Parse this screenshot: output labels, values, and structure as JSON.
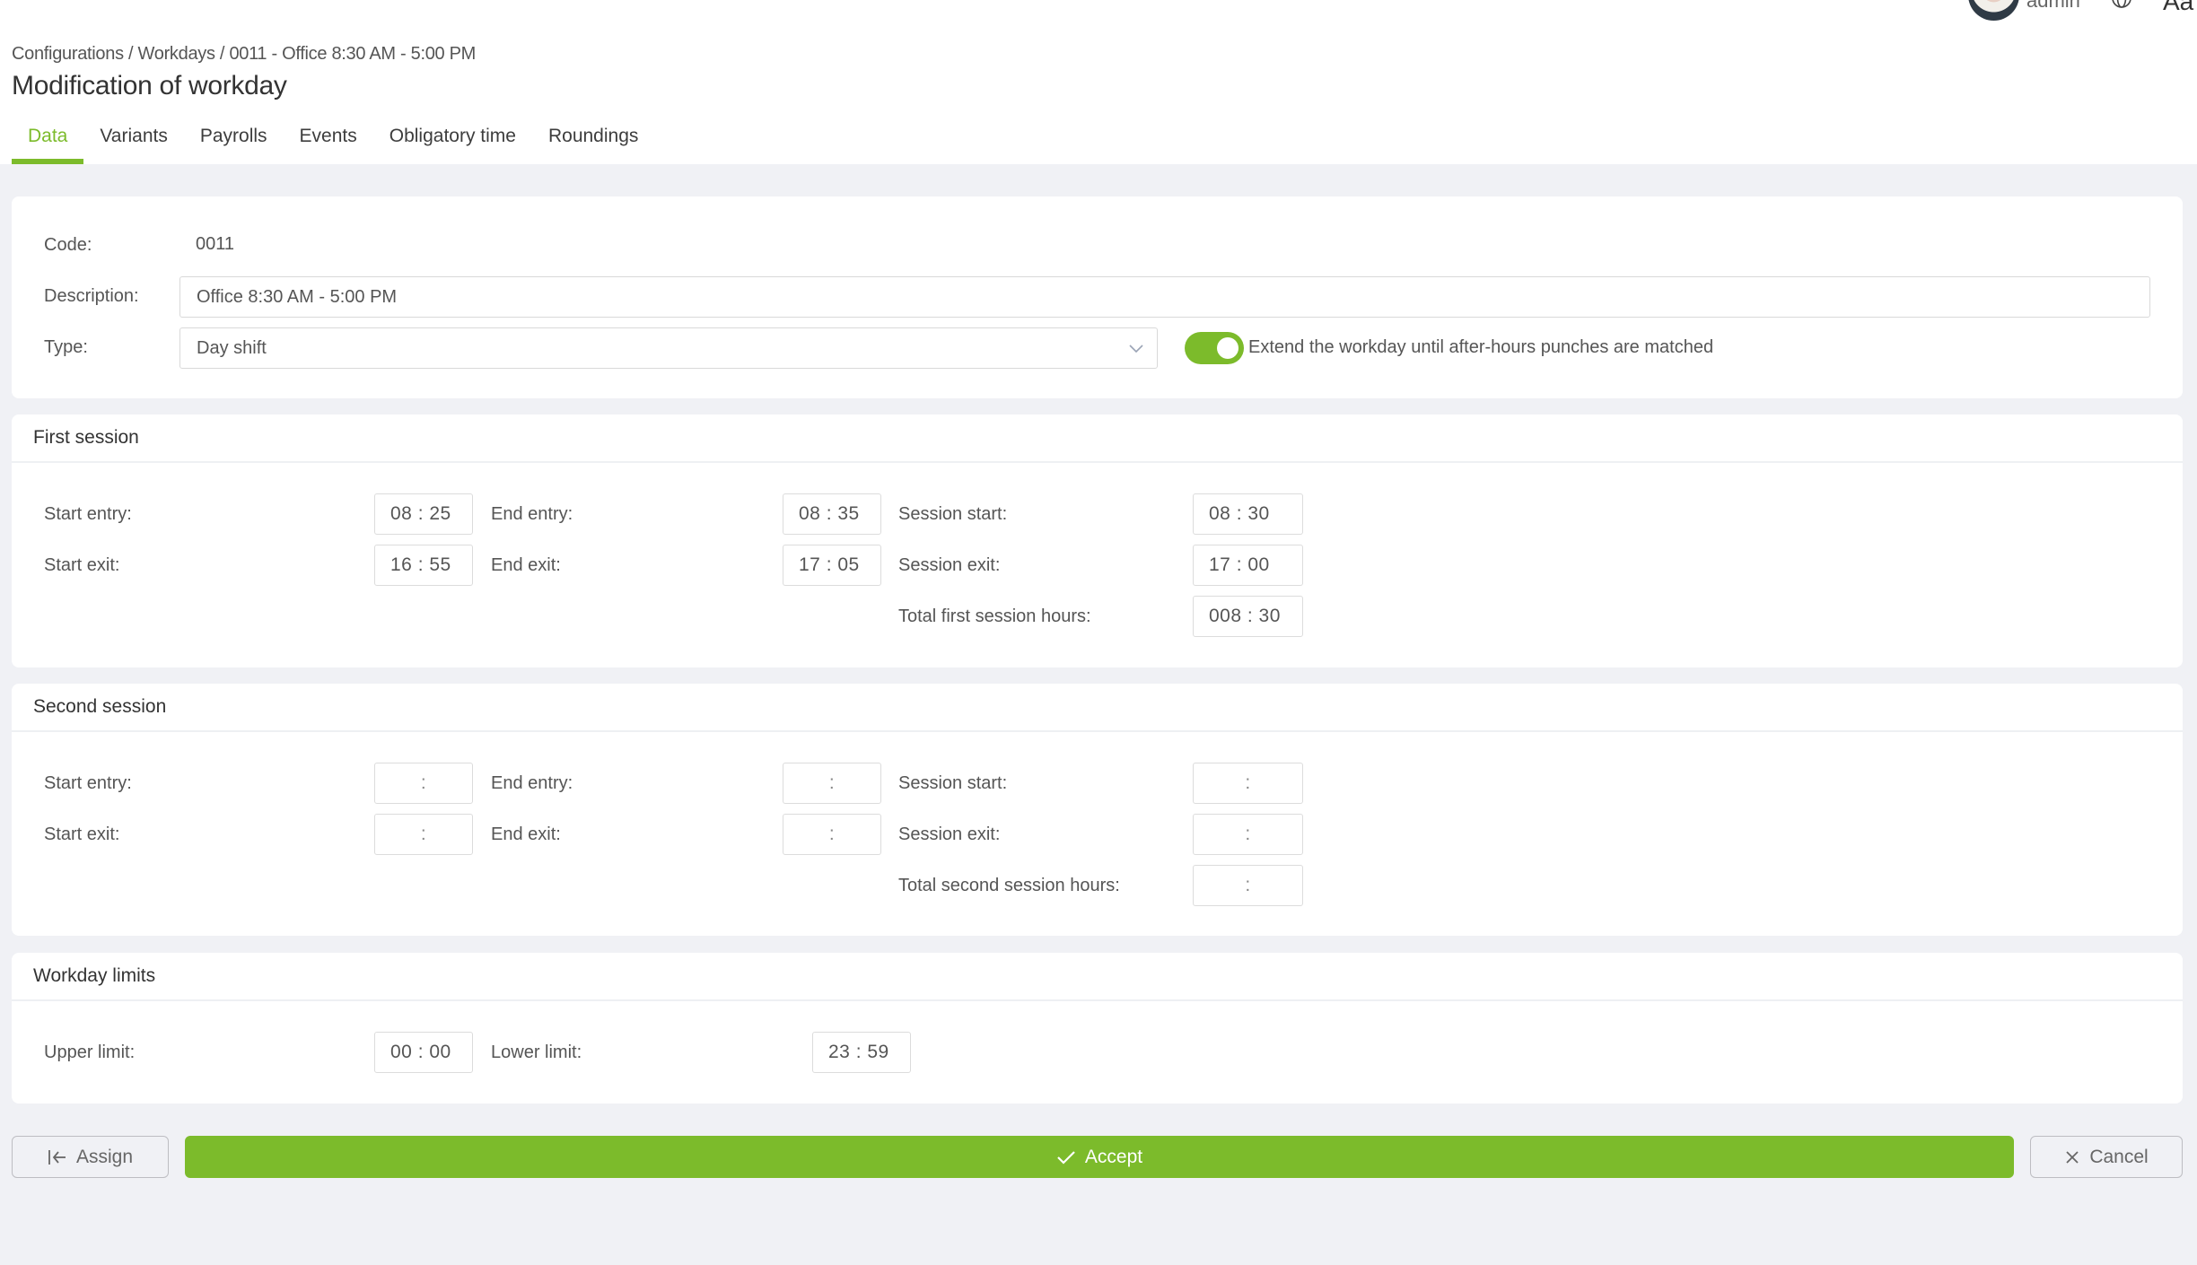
{
  "topbar": {
    "user_name": "admin",
    "language_label": "Aa",
    "icons": {
      "avatar": "user-avatar",
      "globe": "globe-icon"
    }
  },
  "header": {
    "breadcrumb": "Configurations / Workdays / 0011 - Office 8:30 AM - 5:00 PM",
    "title": "Modification of workday",
    "tabs": [
      {
        "label": "Data",
        "active": true
      },
      {
        "label": "Variants",
        "active": false
      },
      {
        "label": "Payrolls",
        "active": false
      },
      {
        "label": "Events",
        "active": false
      },
      {
        "label": "Obligatory time",
        "active": false
      },
      {
        "label": "Roundings",
        "active": false
      }
    ]
  },
  "general": {
    "code_label": "Code:",
    "code_value": "0011",
    "description_label": "Description:",
    "description_value": "Office 8:30 AM - 5:00 PM",
    "type_label": "Type:",
    "type_value": "Day shift",
    "extend_toggle_on": true,
    "extend_label": "Extend the workday until after-hours punches are matched"
  },
  "first_session": {
    "title": "First session",
    "start_entry_label": "Start entry:",
    "start_entry": "08 : 25",
    "start_exit_label": "Start exit:",
    "start_exit": "16 : 55",
    "end_entry_label": "End entry:",
    "end_entry": "08 : 35",
    "end_exit_label": "End exit:",
    "end_exit": "17 : 05",
    "session_start_label": "Session start:",
    "session_start": "08 : 30",
    "session_exit_label": "Session exit:",
    "session_exit": "17 : 00",
    "total_label": "Total first session hours:",
    "total": "008 : 30"
  },
  "second_session": {
    "title": "Second session",
    "start_entry_label": "Start entry:",
    "start_entry": ":",
    "start_exit_label": "Start exit:",
    "start_exit": ":",
    "end_entry_label": "End entry:",
    "end_entry": ":",
    "end_exit_label": "End exit:",
    "end_exit": ":",
    "session_start_label": "Session start:",
    "session_start": ":",
    "session_exit_label": "Session exit:",
    "session_exit": ":",
    "total_label": "Total second session hours:",
    "total": ":"
  },
  "limits": {
    "title": "Workday limits",
    "upper_label": "Upper limit:",
    "upper": "00 : 00",
    "lower_label": "Lower limit:",
    "lower": "23 : 59"
  },
  "actions": {
    "assign_label": "Assign",
    "accept_label": "Accept",
    "cancel_label": "Cancel"
  },
  "colors": {
    "accent": "#7cbb2b",
    "background": "#f0f1f5"
  }
}
